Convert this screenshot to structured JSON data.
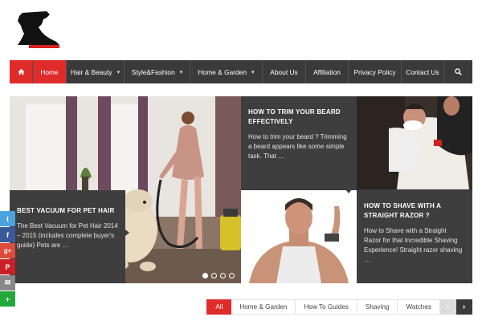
{
  "nav": {
    "items": [
      {
        "label": "Home",
        "dropdown": false,
        "active": true
      },
      {
        "label": "Hair & Beauty",
        "dropdown": true
      },
      {
        "label": "Style&Fashion",
        "dropdown": true
      },
      {
        "label": "Home & Garden",
        "dropdown": true
      },
      {
        "label": "About Us",
        "dropdown": false
      },
      {
        "label": "Affiliation",
        "dropdown": false
      },
      {
        "label": "Privacy Policy",
        "dropdown": false
      },
      {
        "label": "Contact Us",
        "dropdown": false
      }
    ],
    "chevron": "▾",
    "search_icon": "search-icon",
    "home_icon": "house-icon"
  },
  "posts": {
    "trim": {
      "title": "HOW TO TRIM YOUR BEARD EFFECTIVELY",
      "excerpt": "How to trim your beard ? Trimming a beard appears like some simple task. That …"
    },
    "vacuum": {
      "title": "BEST VACUUM FOR PET HAIR",
      "excerpt": "The Best Vacuum for Pet Hair 2014 – 2015 (includes complete buyer's guide) Pets are …"
    },
    "shave": {
      "title": "HOW TO SHAVE WITH A STRAIGHT RAZOR ?",
      "excerpt": "How to Shave with a Straight Razor for that Incredible Shaving Experience! Straight razor shaving …"
    }
  },
  "slider": {
    "dot_count": 4,
    "active_dot": 0
  },
  "share": {
    "twitter": "t",
    "facebook": "f",
    "googleplus": "g+",
    "pinterest": "P",
    "email": "✉",
    "more": "+"
  },
  "filters": {
    "items": [
      "All",
      "Home & Garden",
      "How To Guides",
      "Shaving",
      "Watches"
    ],
    "active": "All",
    "prev": "‹",
    "next": "›"
  },
  "colors": {
    "accent": "#e02b2b",
    "nav_bg": "#3a3a3a",
    "box_bg": "#3e3e3e"
  }
}
